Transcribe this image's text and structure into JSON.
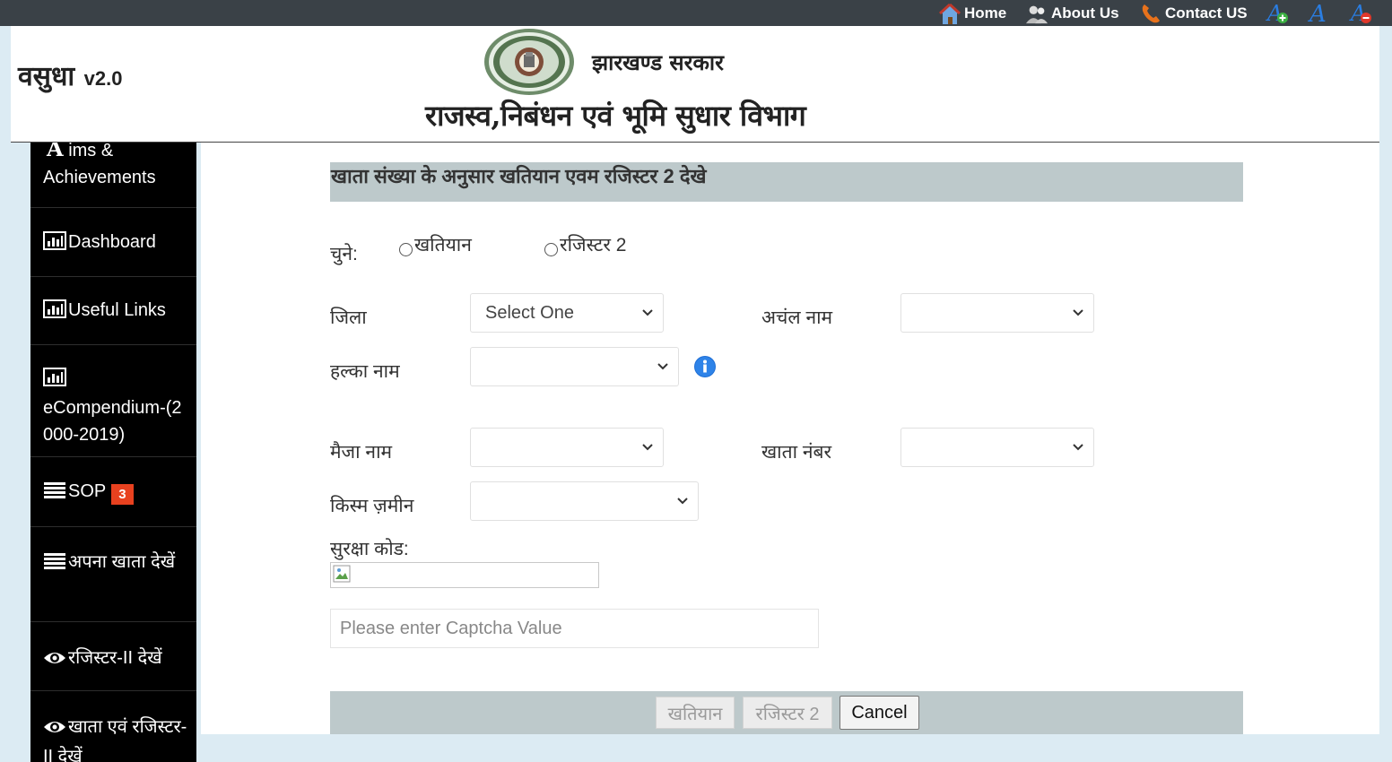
{
  "topbar": {
    "home_label": "Home",
    "about_label": "About Us",
    "contact_label": "Contact US",
    "font_increase_icon": "font-increase-icon",
    "font_normal_icon": "font-normal-icon",
    "font_decrease_icon": "font-decrease-icon"
  },
  "header": {
    "app_name": "वसुधा",
    "app_version": "v2.0",
    "gov_name": "झारखण्ड सरकार",
    "dept_name": "राजस्व,निबंधन एवं भूमि सुधार विभाग"
  },
  "sidebar": {
    "items": [
      {
        "label": "ims & Achievements",
        "icon": "aims-icon"
      },
      {
        "label": "Dashboard",
        "icon": "chart-icon"
      },
      {
        "label": "Useful Links",
        "icon": "chart-icon"
      },
      {
        "label": "eCompendium-(2000-2019)",
        "icon": "chart-icon"
      },
      {
        "label": "SOP",
        "icon": "list-icon",
        "badge": "3"
      },
      {
        "label": "अपना खाता देखें",
        "icon": "list-icon"
      },
      {
        "label": "रजिस्टर-II देखें",
        "icon": "eye-icon"
      },
      {
        "label": "खाता एवं रजिस्टर-II देखें",
        "icon": "eye-icon"
      }
    ],
    "first_item_letter": "A"
  },
  "form": {
    "title": "खाता संख्या के अनुसार खतियान एवम रजिस्टर 2 देखे",
    "choose_label": "चुने:",
    "radio_khatiyan": "खतियान",
    "radio_register2": "रजिस्टर 2",
    "district_label": "जिला",
    "district_value": "Select One",
    "anchal_label": "अचंल नाम",
    "anchal_value": "",
    "halka_label": "हल्का नाम",
    "halka_value": "",
    "mauja_label": "मैजा नाम",
    "mauja_value": "",
    "khata_label": "खाता नंबर",
    "khata_value": "",
    "kism_label": "किस्म ज़मीन",
    "kism_value": "",
    "captcha_label": "सुरक्षा कोड:",
    "captcha_placeholder": "Please enter Captcha Value",
    "btn_khatiyan": "खतियान",
    "btn_register2": "रजिस्टर 2",
    "btn_cancel": "Cancel"
  },
  "colors": {
    "topbar": "#3a4147",
    "sidebar": "#000000",
    "title_bar": "#bdc9cb",
    "badge": "#e8411f",
    "info": "#1f6fd6"
  }
}
